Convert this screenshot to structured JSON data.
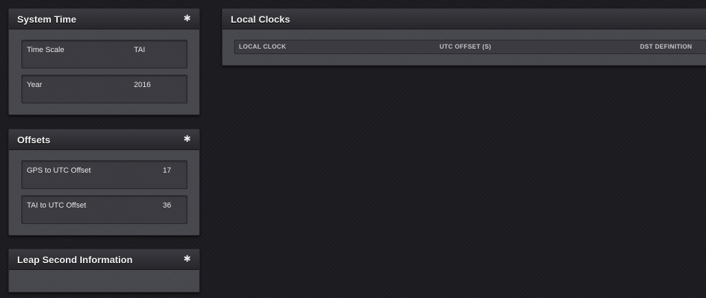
{
  "system_time": {
    "title": "System Time",
    "gear_icon": "gear-icon",
    "fields": [
      {
        "label": "Time Scale",
        "value": "TAI"
      },
      {
        "label": "Year",
        "value": "2016"
      }
    ]
  },
  "offsets": {
    "title": "Offsets",
    "gear_icon": "gear-icon",
    "fields": [
      {
        "label": "GPS to UTC Offset",
        "value": "17"
      },
      {
        "label": "TAI to UTC Offset",
        "value": "36"
      }
    ]
  },
  "leap_second": {
    "title": "Leap Second Information",
    "gear_icon": "gear-icon"
  },
  "local_clocks": {
    "title": "Local Clocks",
    "columns": [
      "LOCAL CLOCK",
      "UTC OFFSET (S)",
      "DST DEFINITION"
    ]
  },
  "colors": {
    "background": "#1c1b20",
    "panel": "#46464d",
    "header": "#2c2c31"
  }
}
